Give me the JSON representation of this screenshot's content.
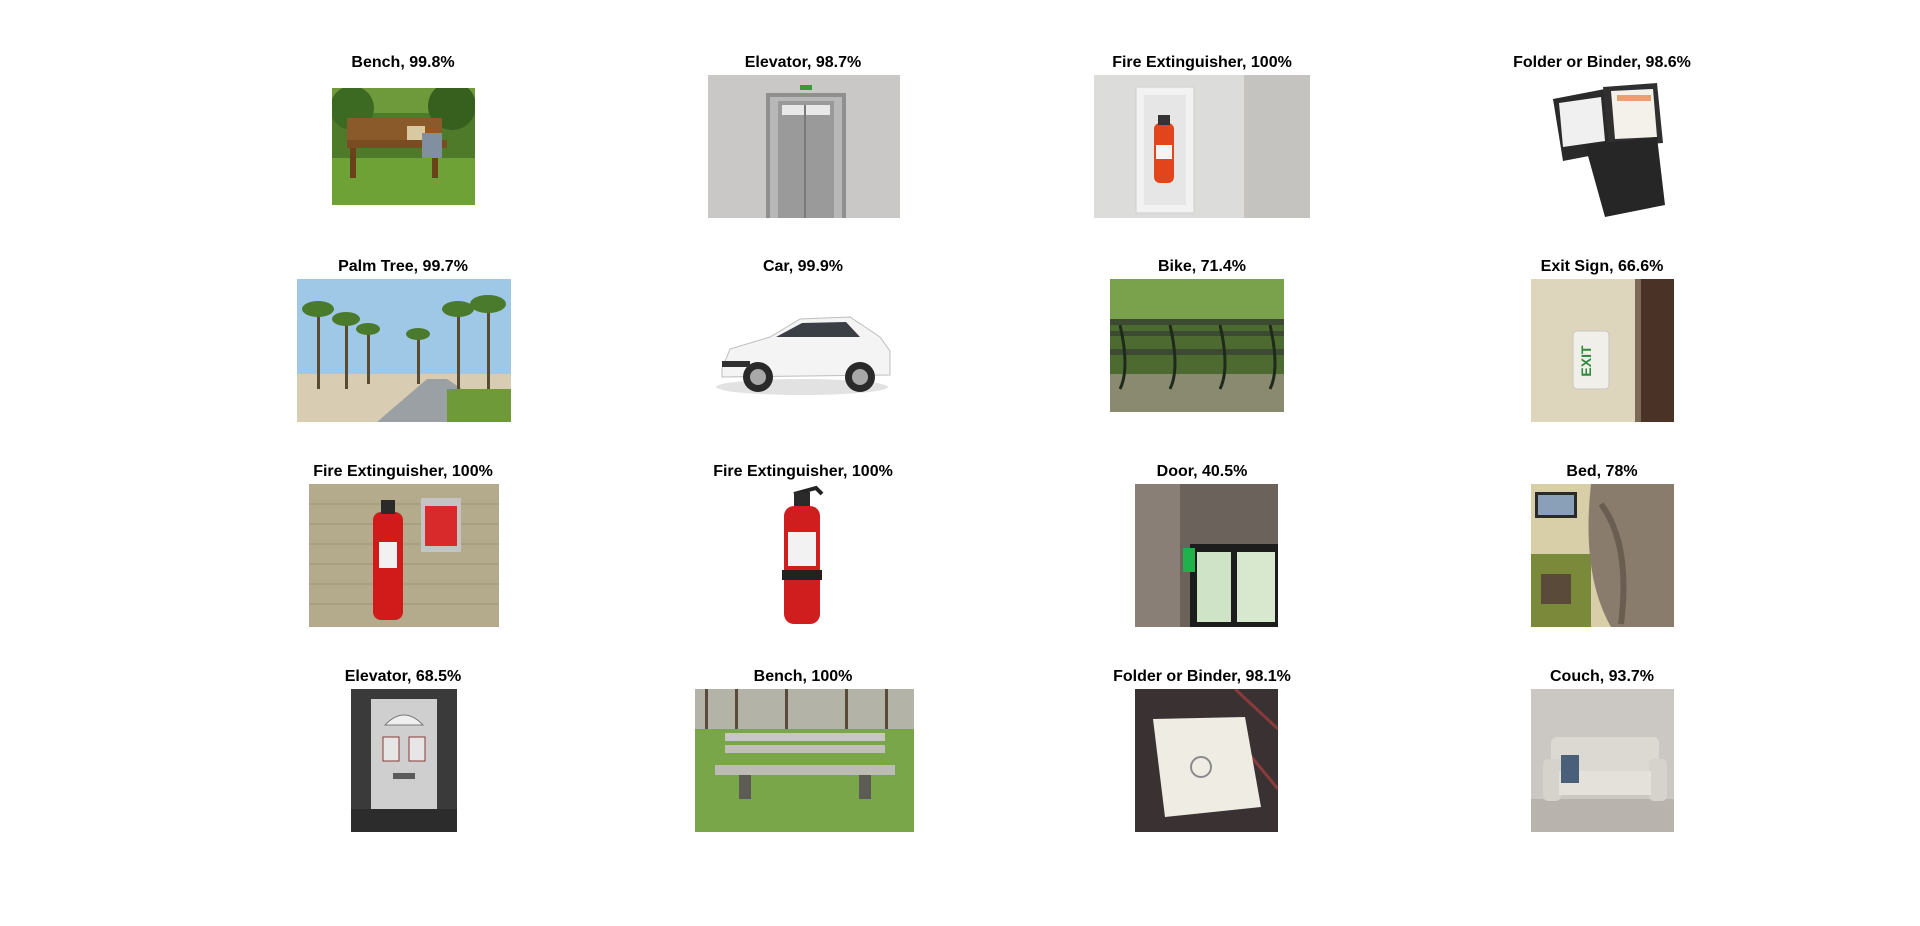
{
  "figure": {
    "panels": [
      {
        "label": "Bench, 99.8%",
        "subject": "park-bench-garden"
      },
      {
        "label": "Elevator, 98.7%",
        "subject": "elevator-doors"
      },
      {
        "label": "Fire Extinguisher, 100%",
        "subject": "extinguisher-cabinet"
      },
      {
        "label": "Folder or Binder, 98.6%",
        "subject": "black-folder"
      },
      {
        "label": "Palm Tree, 99.7%",
        "subject": "palm-trees-path"
      },
      {
        "label": "Car, 99.9%",
        "subject": "white-sedan"
      },
      {
        "label": "Bike, 71.4%",
        "subject": "park-bench-row"
      },
      {
        "label": "Exit Sign, 66.6%",
        "subject": "exit-sign-wall"
      },
      {
        "label": "Fire Extinguisher, 100%",
        "subject": "extinguisher-brick-wall"
      },
      {
        "label": "Fire Extinguisher, 100%",
        "subject": "extinguisher-isolated"
      },
      {
        "label": "Door, 40.5%",
        "subject": "room-corner-window"
      },
      {
        "label": "Bed, 78%",
        "subject": "blanket-tv-room"
      },
      {
        "label": "Elevator, 68.5%",
        "subject": "front-door-hallway"
      },
      {
        "label": "Bench, 100%",
        "subject": "park-bench-meadow"
      },
      {
        "label": "Folder or Binder, 98.1%",
        "subject": "white-folder-shelf"
      },
      {
        "label": "Couch, 93.7%",
        "subject": "grey-sofa"
      }
    ]
  }
}
